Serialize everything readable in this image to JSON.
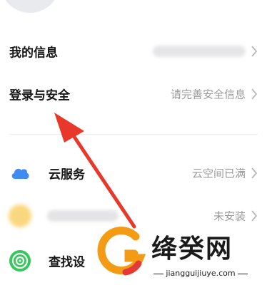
{
  "settings": {
    "my_info": {
      "label": "我的信息",
      "value": ""
    },
    "login_security": {
      "label": "登录与安全",
      "value": "请完善安全信息"
    },
    "cloud_service": {
      "label": "云服务",
      "value": "云空间已满"
    },
    "blurred_app": {
      "label": "",
      "value": "未安装"
    },
    "find_device": {
      "label": "查找设"
    }
  },
  "watermark": {
    "name": "绛癸网",
    "url": "jiangguijiuye.com"
  },
  "colors": {
    "arrow": "#e8382b",
    "cloud_icon": "#3e8cf1",
    "find_icon": "#34c759",
    "watermark_orange": "#f39b14"
  },
  "icons": [
    "avatar",
    "chevron-right-icon",
    "cloud-icon",
    "app-icon",
    "find-device-icon",
    "watermark-logo"
  ]
}
